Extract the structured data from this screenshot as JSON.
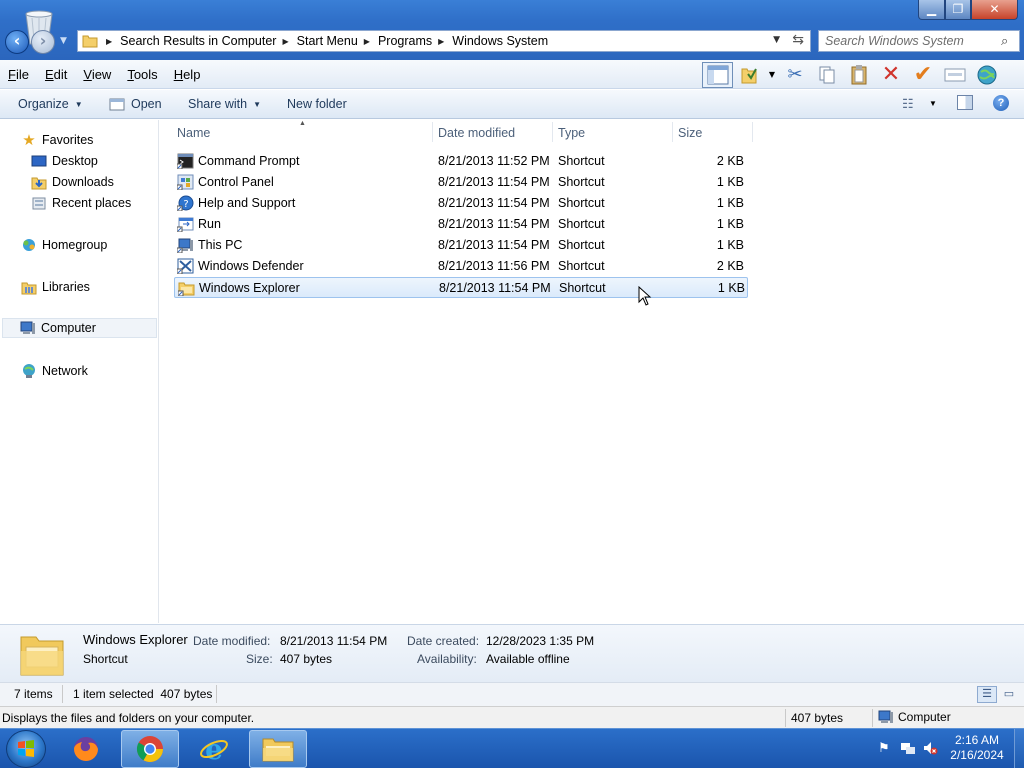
{
  "window": {
    "minimize_glyph": "▁",
    "maximize_glyph": "❐",
    "close_glyph": "✕"
  },
  "address_bar": {
    "breadcrumbs": [
      "Search Results in Computer",
      "Start Menu",
      "Programs",
      "Windows System"
    ]
  },
  "search": {
    "placeholder": "Search Windows System"
  },
  "menu": {
    "items": [
      {
        "first": "F",
        "rest": "ile"
      },
      {
        "first": "E",
        "rest": "dit"
      },
      {
        "first": "V",
        "rest": "iew"
      },
      {
        "first": "T",
        "rest": "ools"
      },
      {
        "first": "H",
        "rest": "elp"
      }
    ]
  },
  "command_bar": {
    "organize": "Organize",
    "open": "Open",
    "share_with": "Share with",
    "new_folder": "New folder"
  },
  "nav_pane": {
    "favorites": "Favorites",
    "desktop": "Desktop",
    "downloads": "Downloads",
    "recent_places": "Recent places",
    "homegroup": "Homegroup",
    "libraries": "Libraries",
    "computer": "Computer",
    "network": "Network"
  },
  "columns": {
    "name": "Name",
    "date_modified": "Date modified",
    "type": "Type",
    "size": "Size"
  },
  "files": [
    {
      "name": "Command Prompt",
      "date": "8/21/2013 11:52 PM",
      "type": "Shortcut",
      "size": "2 KB",
      "icon": "command-prompt-icon"
    },
    {
      "name": "Control Panel",
      "date": "8/21/2013 11:54 PM",
      "type": "Shortcut",
      "size": "1 KB",
      "icon": "control-panel-icon"
    },
    {
      "name": "Help and Support",
      "date": "8/21/2013 11:54 PM",
      "type": "Shortcut",
      "size": "1 KB",
      "icon": "help-support-icon"
    },
    {
      "name": "Run",
      "date": "8/21/2013 11:54 PM",
      "type": "Shortcut",
      "size": "1 KB",
      "icon": "run-icon"
    },
    {
      "name": "This PC",
      "date": "8/21/2013 11:54 PM",
      "type": "Shortcut",
      "size": "1 KB",
      "icon": "this-pc-icon"
    },
    {
      "name": "Windows Defender",
      "date": "8/21/2013 11:56 PM",
      "type": "Shortcut",
      "size": "2 KB",
      "icon": "windows-defender-icon"
    },
    {
      "name": "Windows Explorer",
      "date": "8/21/2013 11:54 PM",
      "type": "Shortcut",
      "size": "1 KB",
      "icon": "windows-explorer-icon",
      "selected": true
    }
  ],
  "details": {
    "name": "Windows Explorer",
    "type": "Shortcut",
    "date_modified_label": "Date modified:",
    "date_modified": "8/21/2013 11:54 PM",
    "size_label": "Size:",
    "size": "407 bytes",
    "date_created_label": "Date created:",
    "date_created": "12/28/2023 1:35 PM",
    "availability_label": "Availability:",
    "availability": "Available offline"
  },
  "status": {
    "item_count": "7 items",
    "selection": "1 item selected  407 bytes",
    "hint": "Displays the files and folders on your computer.",
    "size": "407 bytes",
    "location": "Computer"
  },
  "taskbar": {
    "time": "2:16 AM",
    "date": "2/16/2024",
    "apps": [
      "firefox-icon",
      "chrome-icon",
      "internet-explorer-icon",
      "windows-explorer-icon"
    ]
  },
  "colors": {
    "title_bar": "#2f6fc8",
    "selection": "#dbeafb",
    "taskbar": "#1b55ad"
  }
}
